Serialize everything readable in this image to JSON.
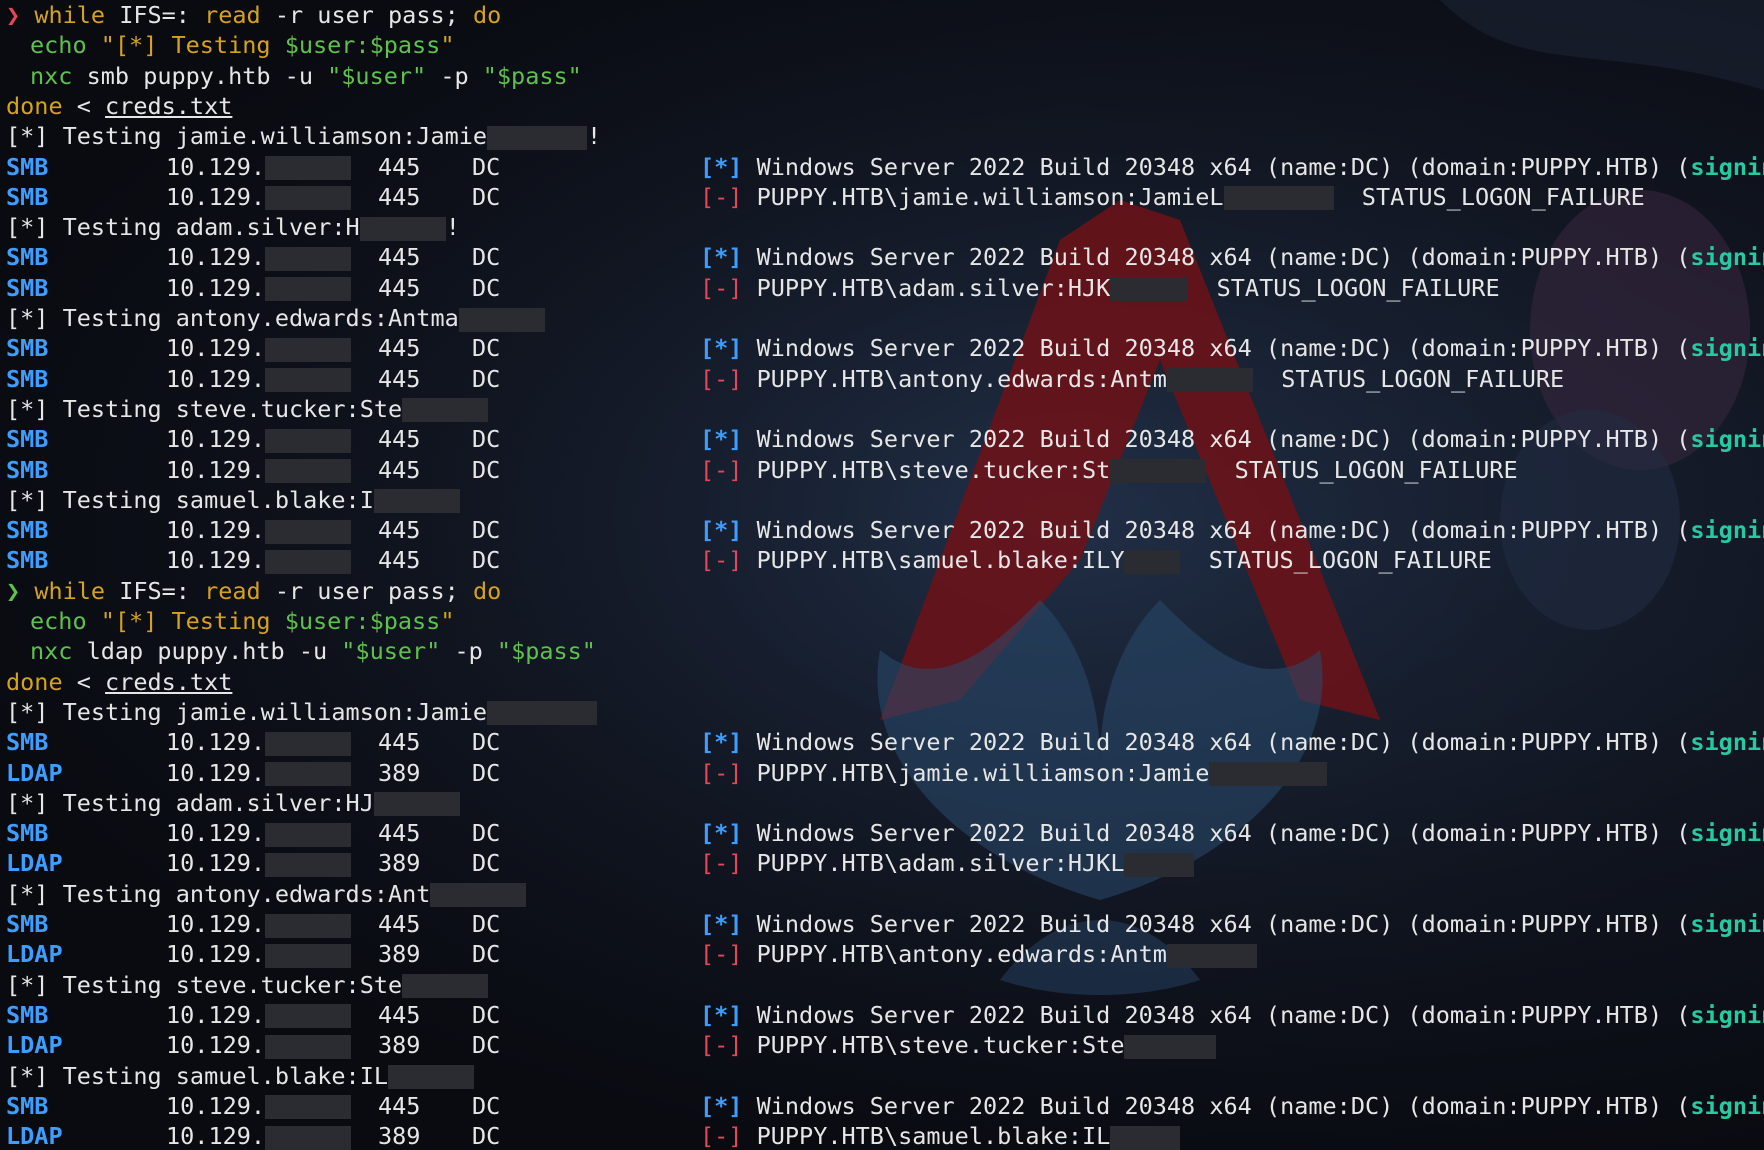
{
  "palette": {
    "background": "#0b0d14",
    "text": "#e6e6e6",
    "prompt_red": "#e8455b",
    "prompt_green": "#5fc14d",
    "keyword": "#d6a21e",
    "tag_blue": "#3d9eff",
    "signing_teal": "#27c9a0",
    "mask": "#2a2c31"
  },
  "icons": {
    "prompt_red": "prompt-arrow-icon",
    "prompt_green": "prompt-arrow-icon"
  },
  "cmd1": {
    "prompt": "❯",
    "while": "while",
    "ifs": " IFS=: ",
    "read": "read",
    "read_args": " -r user pass; ",
    "do": "do",
    "echo_kw": "echo",
    "echo_str": "\"[*] Testing ",
    "echo_var": "$user:$pass",
    "echo_end": "\"",
    "nxc": "nxc",
    "nxc_args": " smb puppy.htb -u ",
    "user_var": "\"$user\"",
    "p_flag": " -p ",
    "pass_var": "\"$pass\"",
    "done": "done",
    "redirect": " < ",
    "file": "creds.txt"
  },
  "cmd2": {
    "prompt": "❯",
    "while": "while",
    "ifs": " IFS=: ",
    "read": "read",
    "read_args": " -r user pass; ",
    "do": "do",
    "echo_kw": "echo",
    "echo_str": "\"[*] Testing ",
    "echo_var": "$user:$pass",
    "echo_end": "\"",
    "nxc": "nxc",
    "nxc_args": " ldap puppy.htb -u ",
    "user_var": "\"$user\"",
    "p_flag": " -p ",
    "pass_var": "\"$pass\"",
    "done": "done",
    "redirect": " < ",
    "file": "creds.txt"
  },
  "testing_prefix": "[*] Testing ",
  "ip_prefix": "10.129.",
  "host": "DC",
  "info_tag": "[*]",
  "fail_tag": "[-]",
  "server_info_text": " Windows Server 2022 Build 20348 x64 (name:DC) (domain:PUPPY.HTB) (",
  "signing_text": "signing:Tr",
  "logon_failure": "STATUS_LOGON_FAILURE",
  "smb_run": [
    {
      "testing": "jamie.williamson:Jamie",
      "testing_end": "!",
      "r1": {
        "proto": "SMB",
        "port": "445"
      },
      "r2": {
        "proto": "SMB",
        "port": "445"
      },
      "fail": "PUPPY.HTB\\jamie.williamson:JamieL",
      "failure": true
    },
    {
      "testing": "adam.silver:H",
      "testing_end": "!",
      "r1": {
        "proto": "SMB",
        "port": "445"
      },
      "r2": {
        "proto": "SMB",
        "port": "445"
      },
      "fail": "PUPPY.HTB\\adam.silver:HJK",
      "failure": true
    },
    {
      "testing": "antony.edwards:Antma",
      "testing_end": "",
      "r1": {
        "proto": "SMB",
        "port": "445"
      },
      "r2": {
        "proto": "SMB",
        "port": "445"
      },
      "fail": "PUPPY.HTB\\antony.edwards:Antm",
      "failure": true
    },
    {
      "testing": "steve.tucker:Ste",
      "testing_end": "",
      "r1": {
        "proto": "SMB",
        "port": "445"
      },
      "r2": {
        "proto": "SMB",
        "port": "445"
      },
      "fail": "PUPPY.HTB\\steve.tucker:St",
      "failure": true
    },
    {
      "testing": "samuel.blake:I",
      "testing_end": "",
      "r1": {
        "proto": "SMB",
        "port": "445"
      },
      "r2": {
        "proto": "SMB",
        "port": "445"
      },
      "fail": "PUPPY.HTB\\samuel.blake:ILY",
      "failure": true
    }
  ],
  "ldap_run": [
    {
      "testing": "jamie.williamson:Jamie",
      "testing_end": "",
      "r1": {
        "proto": "SMB",
        "port": "445"
      },
      "r2": {
        "proto": "LDAP",
        "port": "389"
      },
      "fail": "PUPPY.HTB\\jamie.williamson:Jamie",
      "failure": false
    },
    {
      "testing": "adam.silver:HJ",
      "testing_end": "",
      "r1": {
        "proto": "SMB",
        "port": "445"
      },
      "r2": {
        "proto": "LDAP",
        "port": "389"
      },
      "fail": "PUPPY.HTB\\adam.silver:HJKL",
      "failure": false
    },
    {
      "testing": "antony.edwards:Ant",
      "testing_end": "",
      "r1": {
        "proto": "SMB",
        "port": "445"
      },
      "r2": {
        "proto": "LDAP",
        "port": "389"
      },
      "fail": "PUPPY.HTB\\antony.edwards:Antm",
      "failure": false
    },
    {
      "testing": "steve.tucker:Ste",
      "testing_end": "",
      "r1": {
        "proto": "SMB",
        "port": "445"
      },
      "r2": {
        "proto": "LDAP",
        "port": "389"
      },
      "fail": "PUPPY.HTB\\steve.tucker:Ste",
      "failure": false
    },
    {
      "testing": "samuel.blake:IL",
      "testing_end": "",
      "r1": {
        "proto": "SMB",
        "port": "445"
      },
      "r2": {
        "proto": "LDAP",
        "port": "389"
      },
      "fail": "PUPPY.HTB\\samuel.blake:IL",
      "failure": false
    }
  ]
}
